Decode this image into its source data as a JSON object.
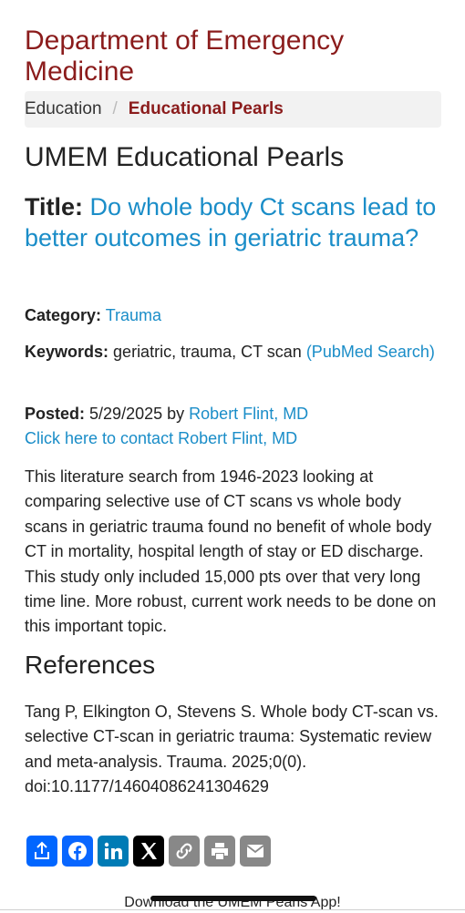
{
  "header": {
    "dept_title": "Department of Emergency Medicine"
  },
  "breadcrumb": {
    "parent": "Education",
    "separator": "/",
    "current": "Educational Pearls"
  },
  "page": {
    "title": "UMEM Educational Pearls"
  },
  "pearl": {
    "title_label": "Title:",
    "title": "Do whole body Ct scans lead to better outcomes in geriatric trauma?",
    "category_label": "Category:",
    "category": "Trauma",
    "keywords_label": "Keywords:",
    "keywords": "geriatric, trauma, CT scan",
    "pubmed_link": "(PubMed Search)",
    "posted_label": "Posted:",
    "posted_date": "5/29/2025",
    "by": "by",
    "author": "Robert Flint, MD",
    "contact_link": "Click here to contact Robert Flint, MD",
    "body": "This literature search from 1946-2023 looking at comparing selective use of CT scans vs whole body scans in geriatric trauma found no benefit of whole body CT in mortality, hospital length of stay or ED discharge. This study only included 15,000 pts over that very long time line. More robust, current work needs to be done on this important topic.",
    "references_heading": "References",
    "reference": "Tang P, Elkington O, Stevens S. Whole body CT-scan vs. selective CT-scan in geriatric trauma: Systematic review and meta-analysis. Trauma. 2025;0(0). doi:10.1177/14604086241304629"
  },
  "share": [
    {
      "icon": "share-icon",
      "color": "#0166ff"
    },
    {
      "icon": "facebook-icon",
      "color": "#0866ff"
    },
    {
      "icon": "linkedin-icon",
      "color": "#007bb5"
    },
    {
      "icon": "x-icon",
      "color": "#000000"
    },
    {
      "icon": "copy-link-icon",
      "color": "#888888"
    },
    {
      "icon": "print-icon",
      "color": "#888888"
    },
    {
      "icon": "email-icon",
      "color": "#888888"
    }
  ],
  "footer": {
    "app_link": "Download the UMEM Pearls App!"
  },
  "colors": {
    "brand": "#8b1c1c",
    "link": "#1a8dc8"
  }
}
